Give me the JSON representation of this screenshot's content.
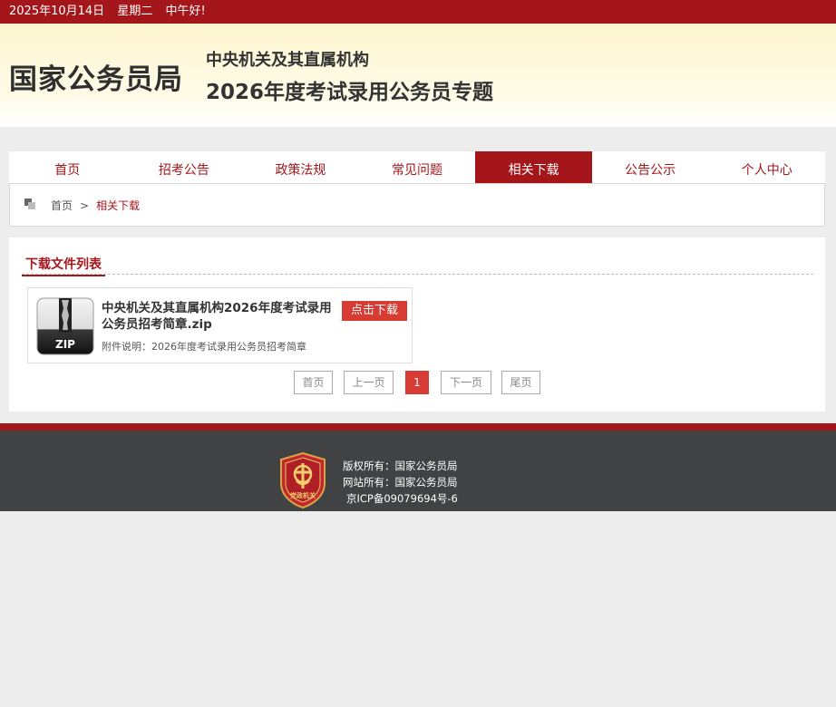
{
  "topbar": {
    "date": "2025年10月14日",
    "weekday": "星期二",
    "greeting": "中午好!"
  },
  "header": {
    "site_name": "国家公务员局",
    "subtitle1": "中央机关及其直属机构",
    "subtitle2": "2026年度考试录用公务员专题"
  },
  "nav": {
    "items": [
      {
        "label": "首页"
      },
      {
        "label": "招考公告"
      },
      {
        "label": "政策法规"
      },
      {
        "label": "常见问题"
      },
      {
        "label": "相关下载"
      },
      {
        "label": "公告公示"
      },
      {
        "label": "个人中心"
      }
    ],
    "active": "相关下载"
  },
  "breadcrumb": {
    "home": "首页",
    "separator": ">",
    "current": "相关下载"
  },
  "section": {
    "title": "下载文件列表"
  },
  "file": {
    "icon": "zip-file-icon",
    "icon_label": "ZIP",
    "name": "中央机关及其直属机构2026年度考试录用公务员招考简章.zip",
    "download_label": "点击下载",
    "desc": "附件说明：2026年度考试录用公务员招考简章"
  },
  "pager": {
    "first": "首页",
    "prev": "上一页",
    "current": "1",
    "next": "下一页",
    "last": "尾页"
  },
  "footer": {
    "emblem_text": "党政机关",
    "copyright": "版权所有：国家公务员局",
    "site_owner": "网站所有：国家公务员局",
    "icp": "京ICP备09079694号-6"
  },
  "colors": {
    "brand_red": "#a5161b",
    "button_red": "#d83a34",
    "footer_bg": "#414243"
  }
}
